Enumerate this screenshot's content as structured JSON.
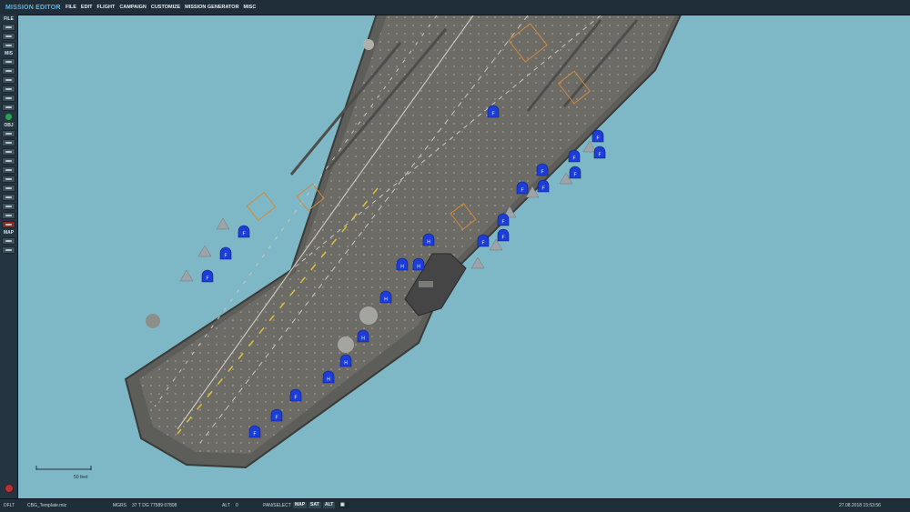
{
  "app": {
    "title": "MISSION EDITOR"
  },
  "menu": [
    "FILE",
    "EDIT",
    "FLIGHT",
    "CAMPAIGN",
    "CUSTOMIZE",
    "MISSION GENERATOR",
    "MISC"
  ],
  "toolbar": {
    "sections": {
      "file": "FILE",
      "mis": "MIS",
      "obj": "OBJ",
      "map": "MAP"
    }
  },
  "map": {
    "scale_label": "50 feet",
    "water_color": "#7eb8c6",
    "deck_color": "#6b6a66",
    "unit_marker_color": "#1c3dd8",
    "unit_markers": [
      "F",
      "F",
      "F",
      "F",
      "F",
      "F",
      "F",
      "F",
      "F",
      "F",
      "H",
      "H",
      "H",
      "H",
      "H",
      "H",
      "H",
      "F",
      "F",
      "F",
      "F",
      "F",
      "F",
      "F"
    ]
  },
  "status": {
    "left": "DFLT",
    "filename": "CBG_Template.miz",
    "coord_system": "MGRS",
    "coords": "37 T DG 77589 07808",
    "alt_label": "ALT",
    "alt_value": "0",
    "mode": "PAN/SELECT",
    "map_btn": "MAP",
    "sat_btn": "SAT",
    "alt_btn": "ALT",
    "datetime": "27.08.2018 15:53:56"
  }
}
